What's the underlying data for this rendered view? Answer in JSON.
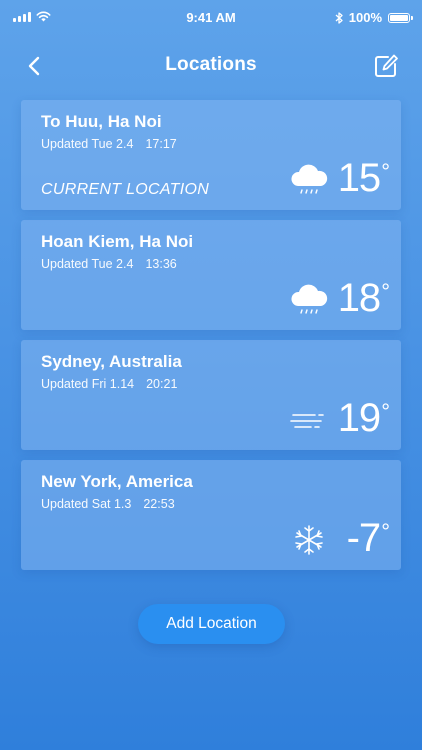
{
  "status_bar": {
    "time": "9:41 AM",
    "battery_text": "100%",
    "battery_level": 1.0,
    "signal_icon": "cellular-signal-icon",
    "wifi_icon": "wifi-icon",
    "bluetooth_icon": "bluetooth-icon"
  },
  "nav": {
    "title": "Locations",
    "back_icon": "chevron-left-icon",
    "edit_icon": "edit-icon"
  },
  "locations": [
    {
      "name": "To Huu, Ha Noi",
      "updated": "Updated Tue 2.4",
      "time": "17:17",
      "label": "CURRENT LOCATION",
      "icon": "cloud-rain-icon",
      "temp": "15"
    },
    {
      "name": "Hoan Kiem, Ha Noi",
      "updated": "Updated Tue 2.4",
      "time": "13:36",
      "label": "",
      "icon": "cloud-rain-icon",
      "temp": "18"
    },
    {
      "name": "Sydney, Australia",
      "updated": "Updated Fri 1.14",
      "time": "20:21",
      "label": "",
      "icon": "wind-icon",
      "temp": "19"
    },
    {
      "name": "New York, America",
      "updated": "Updated Sat 1.3",
      "time": "22:53",
      "label": "",
      "icon": "snowflake-icon",
      "temp": "-7"
    }
  ],
  "degree_symbol": "°",
  "add_button_label": "Add Location",
  "colors": {
    "background_top": "#5ea3ea",
    "background_bottom": "#2f7fdb",
    "card": "#82b4f0",
    "button": "#2a8ff0"
  }
}
